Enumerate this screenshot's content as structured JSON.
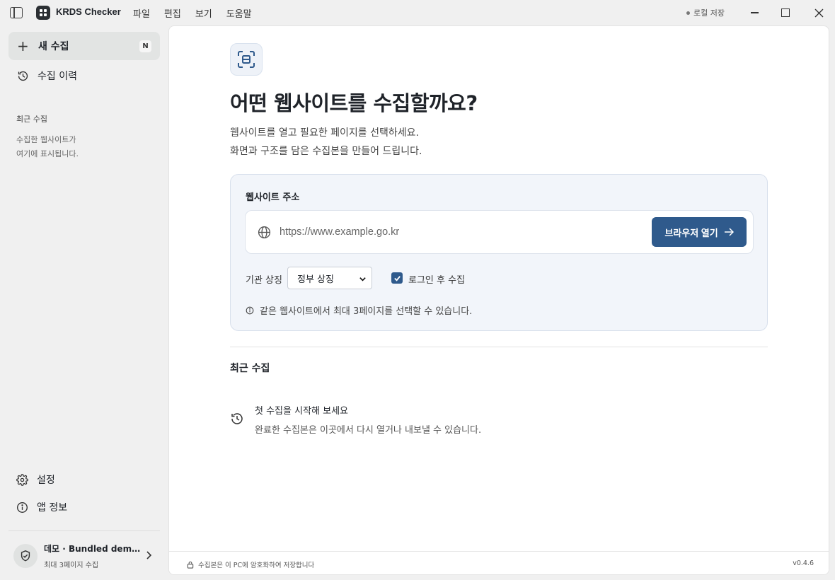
{
  "titlebar": {
    "app_name": "KRDS Checker",
    "menus": [
      "파일",
      "편집",
      "보기",
      "도움말"
    ],
    "save_status": "로컬 저장"
  },
  "sidebar": {
    "new_capture_label": "새 수집",
    "new_capture_shortcut": "N",
    "history_label": "수집 이력",
    "recent_title": "최근 수집",
    "recent_empty_line1": "수집한 웹사이트가",
    "recent_empty_line2": "여기에 표시됩니다.",
    "settings_label": "설정",
    "about_label": "앱 정보",
    "profile_name": "데모 · Bundled demo · release",
    "profile_sub": "최대 3페이지 수집"
  },
  "main": {
    "headline": "어떤 웹사이트를 수집할까요?",
    "desc_line1": "웹사이트를 열고 필요한 페이지를 선택하세요.",
    "desc_line2": "화면과 구조를 담은 수집본을 만들어 드립니다.",
    "url_label": "웹사이트 주소",
    "url_placeholder": "https://www.example.go.kr",
    "open_button": "브라우저 열기",
    "emblem_label": "기관 상징",
    "emblem_selected": "정부 상징",
    "login_checkbox_label": "로그인 후 수집",
    "login_checked": true,
    "info_text": "같은 웹사이트에서 최대 3페이지를 선택할 수 있습니다.",
    "recent_heading": "최근 수집",
    "empty_title": "첫 수집을 시작해 보세요",
    "empty_sub": "완료한 수집본은 이곳에서 다시 열거나 내보낼 수 있습니다."
  },
  "footer": {
    "secure_text": "수집본은 이 PC에 암호화하여 저장합니다",
    "version": "v0.4.6"
  },
  "colors": {
    "accent": "#2f5a8c",
    "card_bg": "#f2f5fa",
    "sidebar_bg": "#f0f0f0"
  }
}
